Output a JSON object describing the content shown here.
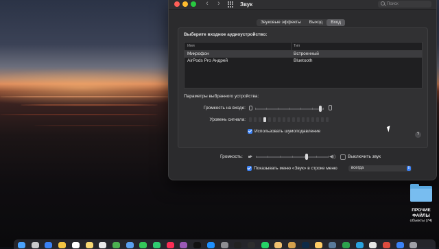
{
  "window": {
    "title": "Звук",
    "search_placeholder": "Поиск",
    "tabs": [
      {
        "label": "Звуковые эффекты",
        "selected": false
      },
      {
        "label": "Выход",
        "selected": false
      },
      {
        "label": "Вход",
        "selected": true
      }
    ],
    "section_title": "Выберите входное аудиоустройство:",
    "table": {
      "headers": [
        "Имя",
        "Тип"
      ],
      "rows": [
        {
          "name": "Микрофон",
          "type": "Встроенный",
          "selected": true
        },
        {
          "name": "AirPods Pro Андрей",
          "type": "Bluetooth",
          "selected": false
        }
      ]
    },
    "params_title": "Параметры выбранного устройства:",
    "input_volume_label": "Громкость на входе:",
    "input_volume_level": 0.95,
    "signal_level_label": "Уровень сигнала:",
    "signal_level": 0.2,
    "noise_reduction_label": "Использовать шумоподавление",
    "noise_reduction_checked": true,
    "help_label": "?",
    "output_volume_label": "Громкость:",
    "output_volume_level": 0.7,
    "mute_label": "Выключить звук",
    "mute_checked": false,
    "menu_bar_label": "Показывать меню «Звук» в строке меню",
    "menu_bar_checked": true,
    "menu_bar_select_value": "всегда"
  },
  "desktop": {
    "folder_name": "ПРОЧИЕ ФАЙЛЫ",
    "folder_subtitle": "объекты (74)"
  },
  "colors": {
    "window_bg": "#2b2b2d",
    "accent": "#3b82f6",
    "close": "#ff5f57",
    "minimize": "#febc2e",
    "maximize": "#28c840",
    "folder": "#5aa8e0"
  },
  "dock_icons": [
    "finder-icon",
    "launchpad-icon",
    "safari-icon",
    "photos-icon",
    "calendar-icon",
    "notes-icon",
    "reminders-icon",
    "maps-icon",
    "mail-icon",
    "messages-icon",
    "facetime-icon",
    "music-icon",
    "podcasts-icon",
    "tv-icon",
    "appstore-icon",
    "settings-icon",
    "terminal-icon",
    "activity-icon",
    "whatsapp-icon",
    "pencil-icon",
    "brush-icon",
    "photoshop-icon",
    "photo-icon",
    "mountain-icon",
    "numbers-icon",
    "telegram-icon",
    "app-icon",
    "chrome-icon",
    "downloads-icon",
    "trash-icon"
  ]
}
